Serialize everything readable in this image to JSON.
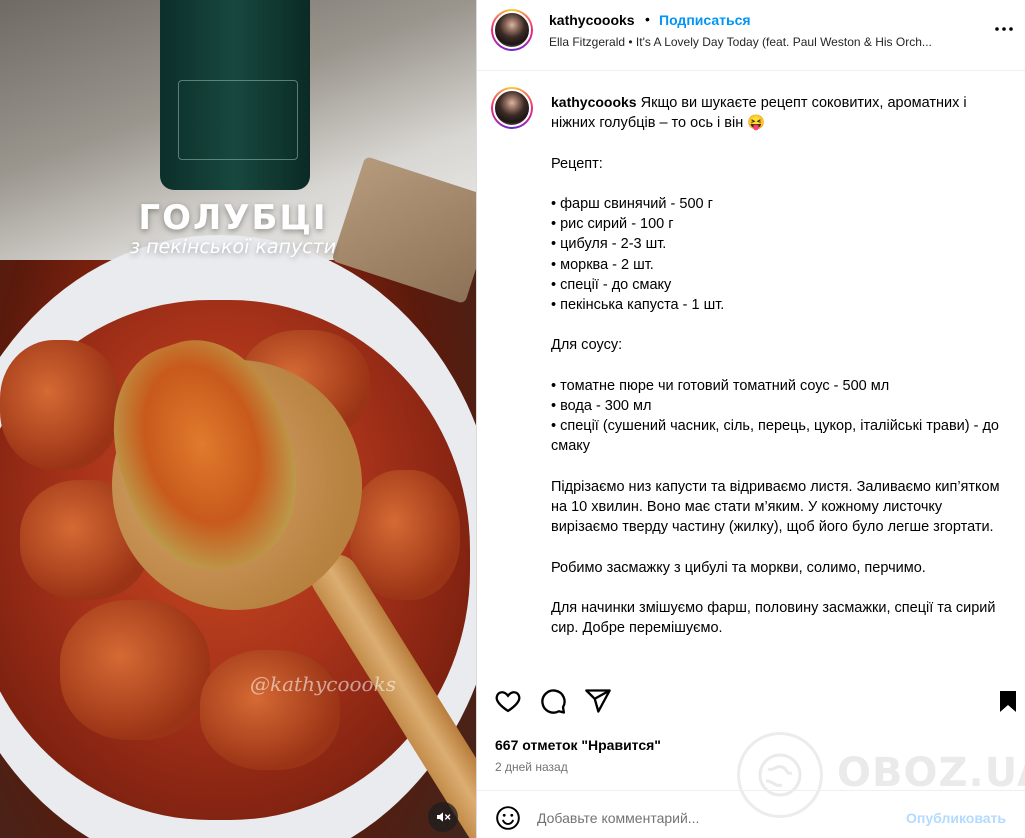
{
  "post": {
    "username": "kathycoooks",
    "follow_label": "Подписаться",
    "separator": "•",
    "audio": "Ella Fitzgerald • It's A Lovely Day Today (feat. Paul Weston & His Orch...",
    "caption_username": "kathycoooks",
    "caption_text": " Якщо ви шукаєте рецепт соковитих, ароматних і ніжних голубців – то ось і він 😝\n\nРецепт:\n\n• фарш свинячий - 500 г\n• рис сирий - 100 г\n• цибуля - 2-3 шт.\n• морква - 2 шт.\n• спеції - до смаку\n• пекінська капуста - 1 шт.\n\nДля соусу:\n\n• томатне пюре чи готовий томатний соус - 500 мл\n• вода - 300 мл\n• спеції (сушений часник, сіль, перець, цукор, італійські трави) - до смаку\n\nПідрізаємо низ капусти та відриваємо листя. Заливаємо кип’ятком на 10 хвилин. Воно має стати м’яким. У кожному листочку вирізаємо тверду частину (жилку), щоб його було легше згортати.\n\nРобимо засмажку з цибулі та моркви, солимо, перчимо.\n\nДля начинки змішуємо фарш, половину засмажки, спеції та сирий сир. Добре перемішуємо.",
    "likes": "667 отметок \"Нравится\"",
    "date": "2 дней назад"
  },
  "media": {
    "title": "ГОЛУБЦІ",
    "subtitle": "з пекінської капусти",
    "watermark": "@kathycoooks",
    "mute_icon": "speaker-muted-icon"
  },
  "comment": {
    "placeholder": "Добавьте комментарий...",
    "publish_label": "Опубликовать"
  },
  "watermark_site": {
    "text": "OBOZ.UA"
  },
  "icons": {
    "like": "heart-icon",
    "comment": "comment-bubble-icon",
    "share": "paper-plane-icon",
    "save": "bookmark-icon",
    "more": "more-horizontal-icon",
    "emoji": "smiley-icon"
  },
  "colors": {
    "link_blue": "#0095f6",
    "publish_disabled": "#b3dbff",
    "secondary_text": "#737373"
  }
}
